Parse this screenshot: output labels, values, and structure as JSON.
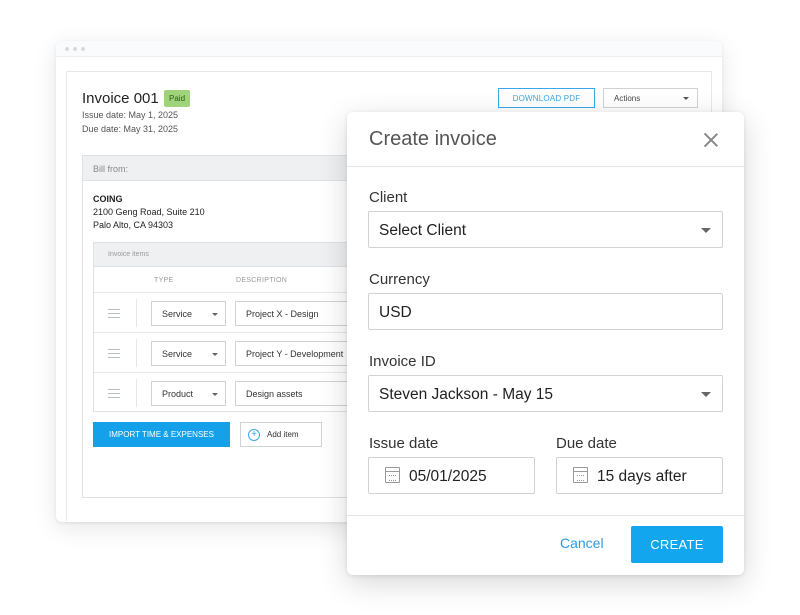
{
  "invoice": {
    "title": "Invoice 001",
    "status": "Paid",
    "issue_date": "Issue date: May 1, 2025",
    "due_date": "Due date: May 31, 2025",
    "download_label": "DOWNLOAD PDF",
    "actions_label": "Actions",
    "bill_from_label": "Bill from:",
    "company": {
      "name": "COING",
      "address1": "2100 Geng Road, Suite 210",
      "address2": "Palo Alto, CA 94303"
    },
    "items_label": "Invoice items",
    "columns": {
      "type": "TYPE",
      "description": "DESCRIPTION"
    },
    "rows": [
      {
        "type": "Service",
        "description": "Project X - Design"
      },
      {
        "type": "Service",
        "description": "Project Y - Development"
      },
      {
        "type": "Product",
        "description": "Design assets"
      }
    ],
    "import_label": "IMPORT TIME & EXPENSES",
    "add_item_label": "Add item"
  },
  "modal": {
    "title": "Create invoice",
    "client_label": "Client",
    "client_value": "Select Client",
    "currency_label": "Currency",
    "currency_value": "USD",
    "invoice_id_label": "Invoice ID",
    "invoice_id_value": "Steven Jackson - May 15",
    "issue_date_label": "Issue date",
    "issue_date_value": "05/01/2025",
    "due_date_label": "Due date",
    "due_date_value": "15 days after",
    "cancel_label": "Cancel",
    "create_label": "CREATE"
  },
  "colors": {
    "accent": "#12a6ee",
    "paid_badge": "#9fd47a"
  },
  "icons": [
    "close-icon",
    "calendar-icon",
    "plus-circle-icon",
    "drag-handle-icon",
    "chevron-down-icon"
  ]
}
